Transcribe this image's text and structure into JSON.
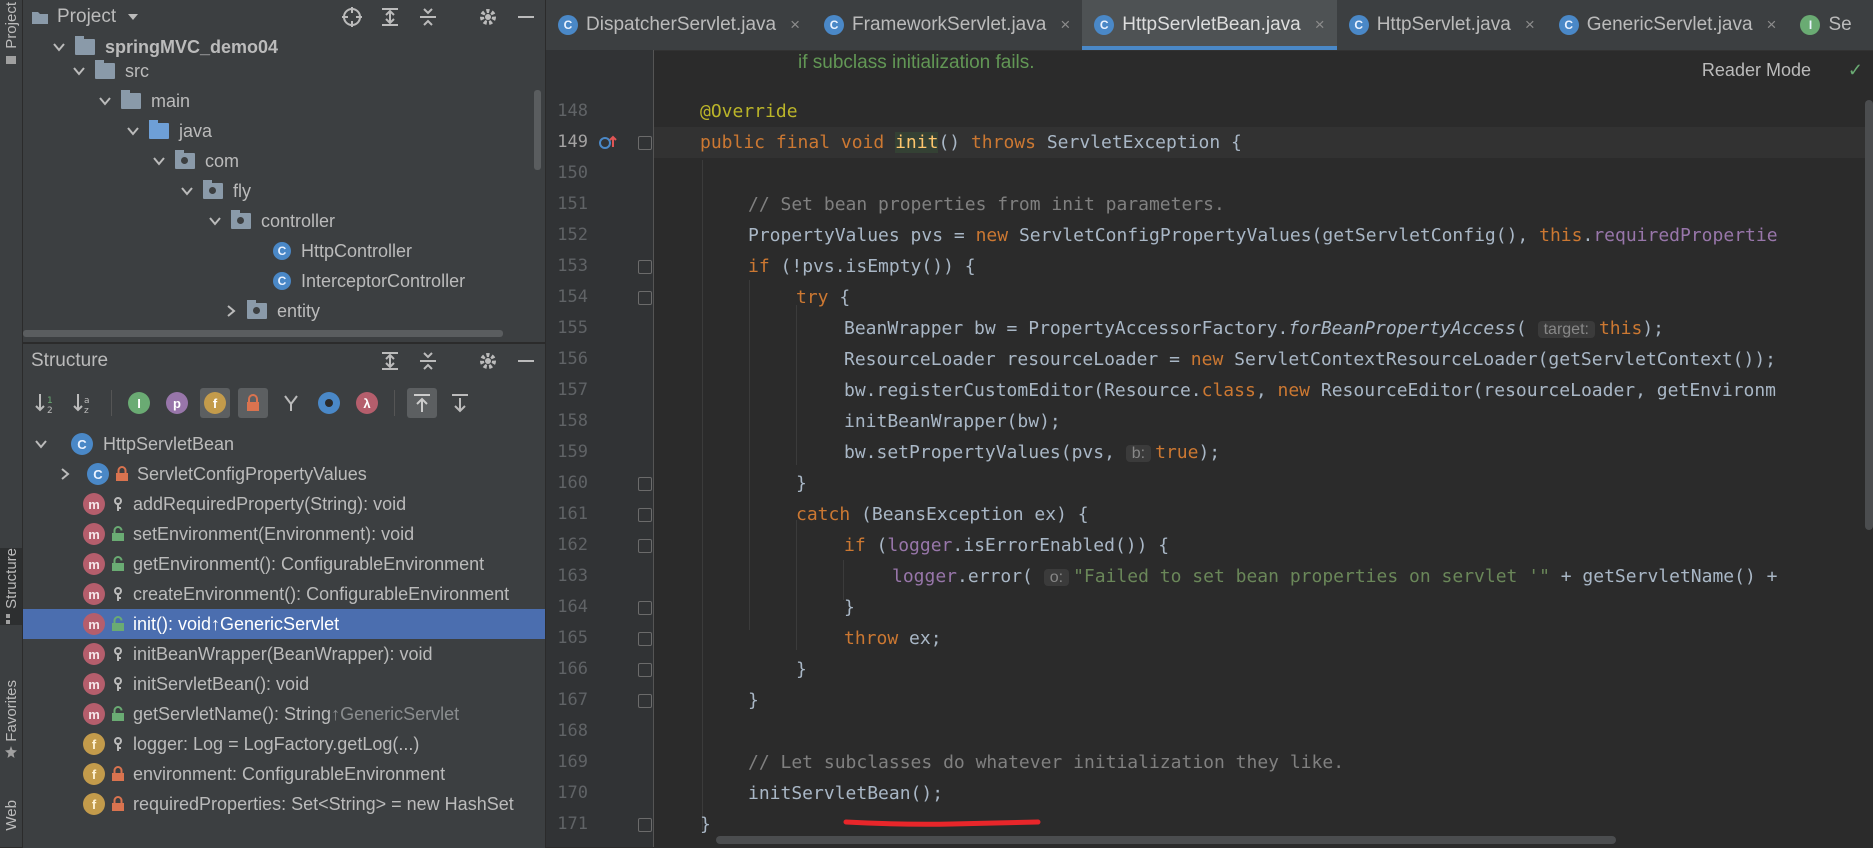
{
  "strip": {
    "project": "Project",
    "structure": "Structure",
    "favorites": "Favorites",
    "web": "Web"
  },
  "project_panel": {
    "title": "Project",
    "tree": [
      {
        "label": "springMVC_demo04",
        "depth": 1,
        "kind": "module",
        "expanded": true
      },
      {
        "label": "src",
        "depth": 2,
        "kind": "folder",
        "expanded": true
      },
      {
        "label": "main",
        "depth": 3,
        "kind": "folder",
        "expanded": true
      },
      {
        "label": "java",
        "depth": 4,
        "kind": "src-folder",
        "expanded": true
      },
      {
        "label": "com",
        "depth": 5,
        "kind": "package",
        "expanded": true
      },
      {
        "label": "fly",
        "depth": 6,
        "kind": "package",
        "expanded": true
      },
      {
        "label": "controller",
        "depth": 7,
        "kind": "package",
        "expanded": true
      },
      {
        "label": "HttpController",
        "depth": 8,
        "kind": "class"
      },
      {
        "label": "InterceptorController",
        "depth": 8,
        "kind": "class"
      },
      {
        "label": "entity",
        "depth": 7,
        "kind": "package",
        "expanded": false
      }
    ]
  },
  "structure_panel": {
    "title": "Structure",
    "root": "HttpServletBean",
    "items": [
      {
        "icon": "c",
        "vis": "lock",
        "text": "ServletConfigPropertyValues",
        "suffix": "",
        "expandable": true
      },
      {
        "icon": "m",
        "vis": "key",
        "text": "addRequiredProperty(String): void",
        "suffix": ""
      },
      {
        "icon": "m",
        "vis": "open",
        "text": "setEnvironment(Environment): void",
        "suffix": ""
      },
      {
        "icon": "m",
        "vis": "open",
        "text": "getEnvironment(): ConfigurableEnvironment",
        "suffix": ""
      },
      {
        "icon": "m",
        "vis": "key",
        "text": "createEnvironment(): ConfigurableEnvironment",
        "suffix": ""
      },
      {
        "icon": "m",
        "vis": "open",
        "text": "init(): void ",
        "suffix": "↑GenericServlet",
        "selected": true
      },
      {
        "icon": "m",
        "vis": "key",
        "text": "initBeanWrapper(BeanWrapper): void",
        "suffix": ""
      },
      {
        "icon": "m",
        "vis": "key",
        "text": "initServletBean(): void",
        "suffix": ""
      },
      {
        "icon": "m",
        "vis": "open",
        "text": "getServletName(): String ",
        "suffix": "↑GenericServlet"
      },
      {
        "icon": "f",
        "vis": "key",
        "text": "logger: Log = LogFactory.getLog(...)",
        "suffix": ""
      },
      {
        "icon": "f",
        "vis": "lock",
        "text": "environment: ConfigurableEnvironment",
        "suffix": ""
      },
      {
        "icon": "f",
        "vis": "lock",
        "text": "requiredProperties: Set<String> = new HashSet",
        "suffix": ""
      }
    ]
  },
  "editor": {
    "tabs": [
      {
        "label": "DispatcherServlet.java",
        "icon": "C",
        "active": false
      },
      {
        "label": "FrameworkServlet.java",
        "icon": "C",
        "active": false
      },
      {
        "label": "HttpServletBean.java",
        "icon": "C",
        "active": true
      },
      {
        "label": "HttpServlet.java",
        "icon": "C",
        "active": false
      },
      {
        "label": "GenericServlet.java",
        "icon": "C",
        "active": false
      },
      {
        "label": "Se",
        "icon": "I",
        "active": false
      }
    ],
    "close_glyph": "×",
    "reader_mode": "Reader Mode",
    "doc_line": "if subclass initialization fails.",
    "line_numbers": [
      "148",
      "149",
      "150",
      "151",
      "152",
      "153",
      "154",
      "155",
      "156",
      "157",
      "158",
      "159",
      "160",
      "161",
      "162",
      "163",
      "164",
      "165",
      "166",
      "167",
      "168",
      "169",
      "170",
      "171"
    ],
    "current_line": "149",
    "code": {
      "l148": "@Override",
      "l149_a": "public final void ",
      "l149_b": "init",
      "l149_c": "() ",
      "l149_d": "throws ",
      "l149_e": "ServletException {",
      "l151": "// Set bean properties from init parameters.",
      "l152_a": "PropertyValues pvs = ",
      "l152_b": "new ",
      "l152_c": "ServletConfigPropertyValues(getServletConfig(), ",
      "l152_d": "this",
      "l152_e": ".",
      "l152_f": "requiredPropertie",
      "l153_a": "if ",
      "l153_b": "(!pvs.isEmpty()) {",
      "l154_a": "try ",
      "l154_b": "{",
      "l155_a": "BeanWrapper bw = PropertyAccessorFactory.",
      "l155_b": "forBeanPropertyAccess",
      "l155_c": "( ",
      "l155_hint": "target:",
      "l155_d": "this",
      "l155_e": ");",
      "l156_a": "ResourceLoader resourceLoader = ",
      "l156_b": "new ",
      "l156_c": "ServletContextResourceLoader(getServletContext());",
      "l157_a": "bw.registerCustomEditor(Resource.",
      "l157_b": "class",
      "l157_c": ", ",
      "l157_d": "new ",
      "l157_e": "ResourceEditor(resourceLoader, getEnvironm",
      "l158": "initBeanWrapper(bw);",
      "l159_a": "bw.setPropertyValues(pvs, ",
      "l159_hint": "b:",
      "l159_b": "true",
      "l159_c": ");",
      "l160": "}",
      "l161_a": "catch ",
      "l161_b": "(BeansException ex) {",
      "l162_a": "if ",
      "l162_b": "(",
      "l162_c": "logger",
      "l162_d": ".isErrorEnabled()) {",
      "l163_a": "logger",
      "l163_b": ".error( ",
      "l163_hint": "o:",
      "l163_c": "\"Failed to set bean properties on servlet '\"",
      "l163_d": " + getServletName() + ",
      "l164": "}",
      "l165_a": "throw ",
      "l165_b": "ex;",
      "l166": "}",
      "l167": "}",
      "l169": "// Let subclasses do whatever initialization they like.",
      "l170": "initServletBean();",
      "l171": "}"
    }
  },
  "colors": {
    "keyword": "#cc7832",
    "annotation": "#bbb529",
    "comment": "#808080",
    "string": "#6a8759",
    "field": "#9876aa",
    "selection": "#4b6eaf",
    "underline": "#e8262a"
  }
}
